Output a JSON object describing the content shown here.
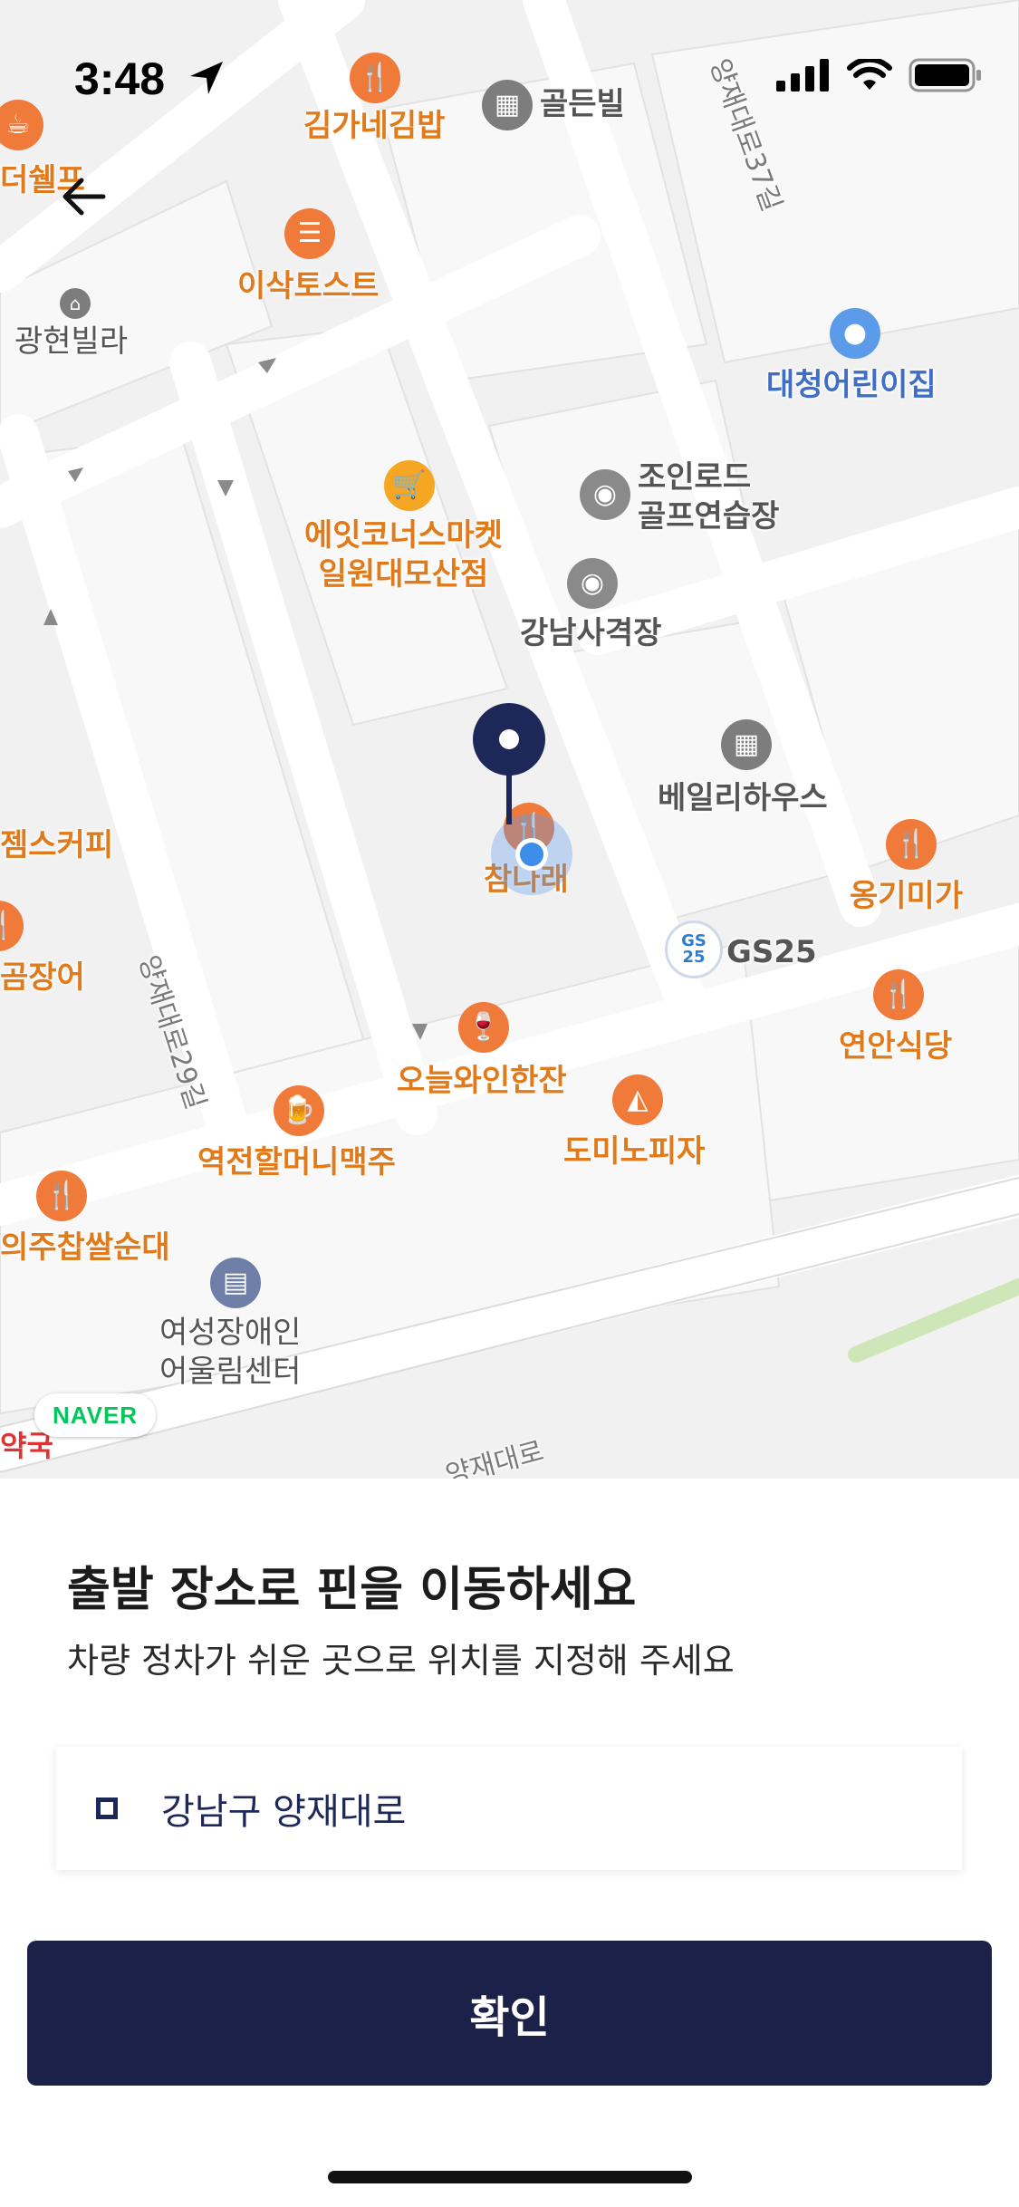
{
  "status_bar": {
    "time": "3:48"
  },
  "map": {
    "pois": [
      {
        "name": "더쉘프",
        "kind": "cafe"
      },
      {
        "name": "김가네김밥",
        "kind": "food"
      },
      {
        "name": "골든빌",
        "kind": "building"
      },
      {
        "name": "이삭토스트",
        "kind": "food"
      },
      {
        "name": "광현빌라",
        "kind": "building"
      },
      {
        "name": "대청어린이집",
        "kind": "kids"
      },
      {
        "name": "조인로드\n골프연습장",
        "kind": "golf"
      },
      {
        "name": "에잇코너스마켓\n일원대모산점",
        "kind": "shop"
      },
      {
        "name": "강남사격장",
        "kind": "golf"
      },
      {
        "name": "베일리하우스",
        "kind": "building"
      },
      {
        "name": "젬스커피",
        "kind": "cafe"
      },
      {
        "name": "참나래",
        "kind": "food"
      },
      {
        "name": "옹기미가",
        "kind": "food"
      },
      {
        "name": "곰장어",
        "kind": "food"
      },
      {
        "name": "GS25",
        "kind": "store"
      },
      {
        "name": "연안식당",
        "kind": "food"
      },
      {
        "name": "오늘와인한잔",
        "kind": "food"
      },
      {
        "name": "도미노피자",
        "kind": "food"
      },
      {
        "name": "역전할머니맥주",
        "kind": "food"
      },
      {
        "name": "의주찹쌀순대",
        "kind": "food"
      },
      {
        "name": "여성장애인\n어울림센터",
        "kind": "public"
      },
      {
        "name": "약국",
        "kind": "pharmacy"
      }
    ],
    "streets": [
      "양재대로37길",
      "양재대로29길",
      "양재대로"
    ],
    "brand": "NAVER"
  },
  "sheet": {
    "title": "출발 장소로 핀을 이동하세요",
    "subtitle": "차량 정차가 쉬운 곳으로 위치를 지정해 주세요",
    "address": "강남구 양재대로",
    "confirm_label": "확인"
  }
}
